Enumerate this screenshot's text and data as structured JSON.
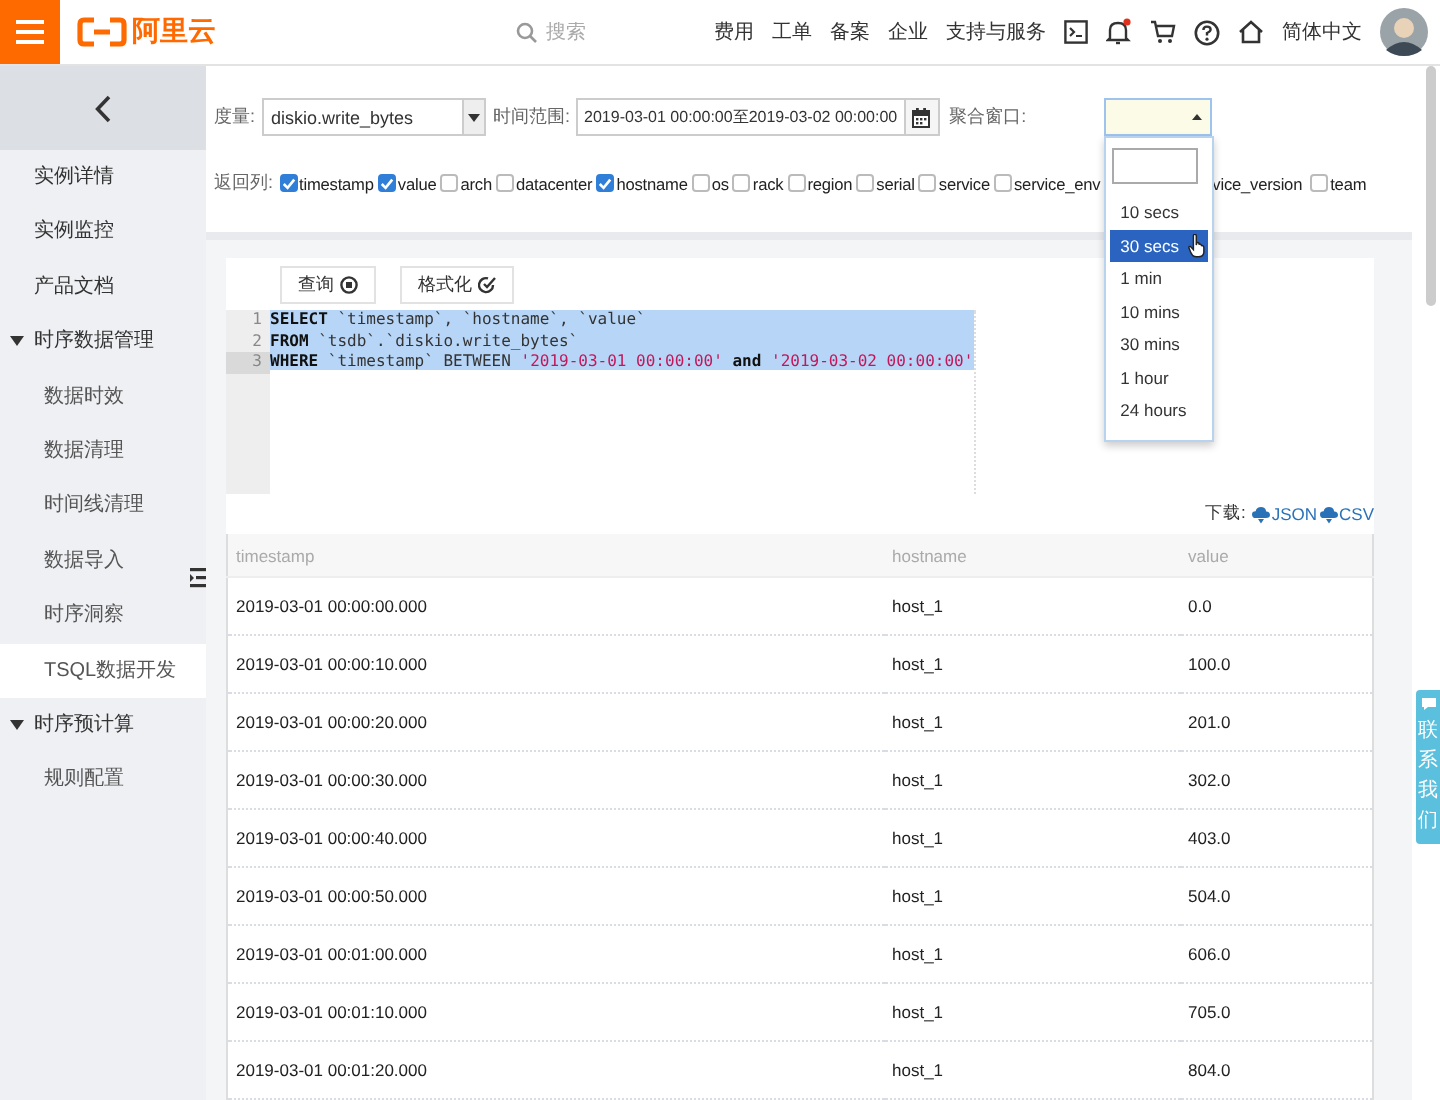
{
  "topbar": {
    "logo": "阿里云",
    "search": {
      "placeholder": "搜索"
    },
    "nav": [
      "费用",
      "工单",
      "备案",
      "企业",
      "支持与服务"
    ],
    "notification_dot": true,
    "language": "简体中文"
  },
  "sidebar": {
    "items": [
      {
        "label": "实例详情",
        "selected": false
      },
      {
        "label": "实例监控",
        "selected": false
      },
      {
        "label": "产品文档",
        "selected": false
      },
      {
        "label": "时序数据管理",
        "selected": false,
        "expanded": true,
        "children": [
          {
            "label": "数据时效",
            "selected": false
          },
          {
            "label": "数据清理",
            "selected": false
          },
          {
            "label": "时间线清理",
            "selected": false
          },
          {
            "label": "数据导入",
            "selected": false
          },
          {
            "label": "时序洞察",
            "selected": false
          },
          {
            "label": "TSQL数据开发",
            "selected": true
          }
        ]
      },
      {
        "label": "时序预计算",
        "selected": false,
        "expanded": true,
        "children": [
          {
            "label": "规则配置",
            "selected": false
          }
        ]
      }
    ]
  },
  "filters": {
    "metric_label": "度量:",
    "metric": "diskio.write_bytes",
    "time_label": "时间范围:",
    "time_range": "2019-03-01 00:00:00至2019-03-02 00:00:00",
    "window_label": "聚合窗口:",
    "window_dropdown": {
      "expanded": true,
      "options": [
        {
          "label": "10 secs",
          "selected": false
        },
        {
          "label": "30 secs",
          "selected": true
        },
        {
          "label": "1 min",
          "selected": false
        },
        {
          "label": "10 mins",
          "selected": false
        },
        {
          "label": "30 mins",
          "selected": false
        },
        {
          "label": "1 hour",
          "selected": false
        },
        {
          "label": "24 hours",
          "selected": false
        }
      ]
    }
  },
  "columns_label": "返回列:",
  "columns": [
    {
      "kind": "checkbox",
      "label": "timestamp",
      "checked": true
    },
    {
      "kind": "checkbox",
      "label": "value",
      "checked": true
    },
    {
      "kind": "checkbox",
      "label": "arch",
      "checked": false
    },
    {
      "kind": "checkbox",
      "label": "datacenter",
      "checked": false
    },
    {
      "kind": "checkbox",
      "label": "hostname",
      "checked": true
    },
    {
      "kind": "checkbox",
      "label": "os",
      "checked": false
    },
    {
      "kind": "checkbox",
      "label": "rack",
      "checked": false
    },
    {
      "kind": "checkbox",
      "label": "region",
      "checked": false
    },
    {
      "kind": "checkbox",
      "label": "serial",
      "checked": false
    },
    {
      "kind": "checkbox",
      "label": "service",
      "checked": false
    },
    {
      "kind": "checkbox",
      "label": "service_env",
      "checked": false
    },
    {
      "kind": "text",
      "label": "vice_version"
    },
    {
      "kind": "checkbox",
      "label": "team",
      "checked": false
    }
  ],
  "editor": {
    "buttons": [
      "查询",
      "格式化"
    ],
    "lines": [
      {
        "number": "1",
        "selected": true,
        "selected_to_line_end": true,
        "active": false,
        "tokens": [
          {
            "kind": "keyword",
            "text": "SELECT"
          },
          {
            "kind": "plain",
            "text": " `timestamp`, `hostname`, `value`"
          }
        ]
      },
      {
        "number": "2",
        "selected": true,
        "selected_to_line_end": true,
        "active": false,
        "tokens": [
          {
            "kind": "keyword",
            "text": "FROM"
          },
          {
            "kind": "plain",
            "text": " `tsdb`.`diskio.write_bytes`"
          }
        ]
      },
      {
        "number": "3",
        "selected": true,
        "selected_to_line_end": false,
        "active": true,
        "tokens": [
          {
            "kind": "keyword",
            "text": "WHERE"
          },
          {
            "kind": "plain",
            "text": " `timestamp` BETWEEN "
          },
          {
            "kind": "string",
            "text": "'2019-03-01 00:00:00'"
          },
          {
            "kind": "keyword",
            "text": " and "
          },
          {
            "kind": "string",
            "text": "'2019-03-02 00:00:00'"
          }
        ]
      }
    ]
  },
  "download": {
    "label": "下载:",
    "links": [
      "JSON",
      "CSV"
    ]
  },
  "table": {
    "columns": [
      "timestamp",
      "hostname",
      "value"
    ],
    "rows": [
      [
        "2019-03-01 00:00:00.000",
        "host_1",
        "0.0"
      ],
      [
        "2019-03-01 00:00:10.000",
        "host_1",
        "100.0"
      ],
      [
        "2019-03-01 00:00:20.000",
        "host_1",
        "201.0"
      ],
      [
        "2019-03-01 00:00:30.000",
        "host_1",
        "302.0"
      ],
      [
        "2019-03-01 00:00:40.000",
        "host_1",
        "403.0"
      ],
      [
        "2019-03-01 00:00:50.000",
        "host_1",
        "504.0"
      ],
      [
        "2019-03-01 00:01:00.000",
        "host_1",
        "606.0"
      ],
      [
        "2019-03-01 00:01:10.000",
        "host_1",
        "705.0"
      ],
      [
        "2019-03-01 00:01:20.000",
        "host_1",
        "804.0"
      ]
    ]
  },
  "contact_tab": "联系我们"
}
